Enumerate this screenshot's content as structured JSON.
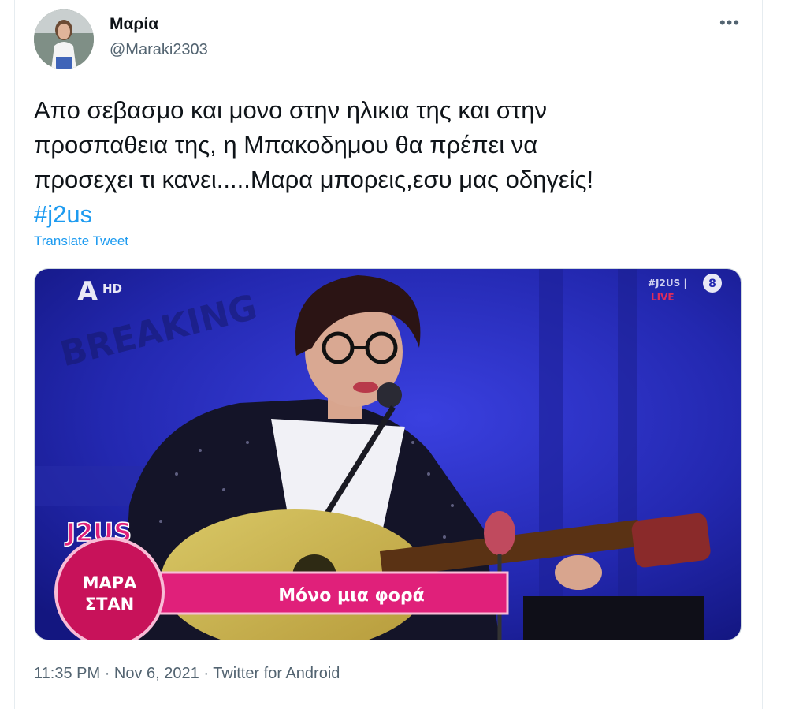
{
  "user": {
    "display_name": "Μαρία",
    "handle": "@Maraki2303",
    "more_icon": "more-horizontal-icon"
  },
  "tweet": {
    "lines": [
      "Απο σεβασμο και μονο στην ηλικια της και στην",
      "προσπαθεια της, η Μπακοδημου θα πρέπει να",
      "προσεχει τι κανει.....Μαρα μπορεις,εσυ μας οδηγείς!"
    ],
    "hashtag": "#j2us",
    "translate_label": "Translate Tweet"
  },
  "media": {
    "channel_logo": "A",
    "channel_hd": "HD",
    "corner_tag": "#J2US |",
    "corner_live": "LIVE",
    "corner_rating": "8",
    "breaking": "BREAKING",
    "show_logo": "J2US",
    "name_line1": "ΜΑΡΑ",
    "name_line2": "ΣΤΑΝ",
    "song_title": "Μόνο μια φορά"
  },
  "meta": {
    "time": "11:35 PM",
    "sep1": "·",
    "date": "Nov 6, 2021",
    "sep2": "·",
    "source": "Twitter for Android"
  },
  "colors": {
    "link": "#1d9bf0",
    "secondary": "#536471",
    "stage_blue": "#2a2fc8",
    "banner_pink": "#e0207a"
  }
}
